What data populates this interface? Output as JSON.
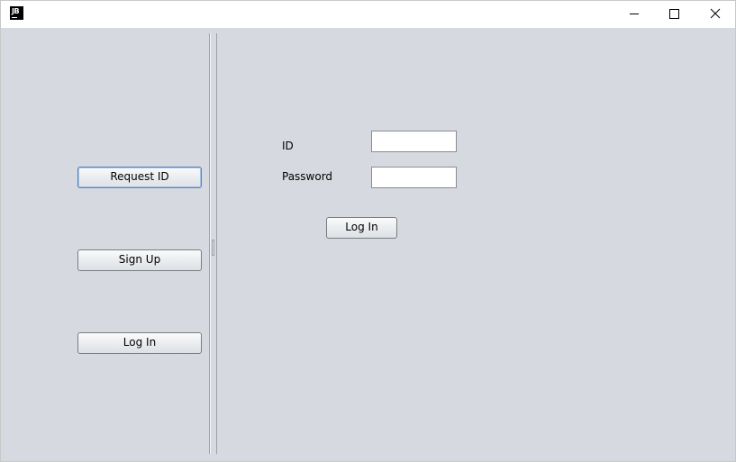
{
  "window": {
    "icon_text": "JB",
    "controls": {
      "minimize_icon": "minimize-icon",
      "maximize_icon": "maximize-icon",
      "close_icon": "close-icon"
    }
  },
  "left_panel": {
    "request_id_label": "Request ID",
    "sign_up_label": "Sign Up",
    "log_in_label": "Log In"
  },
  "login_form": {
    "id_label": "ID",
    "id_value": "",
    "password_label": "Password",
    "password_value": "",
    "submit_label": "Log In"
  },
  "colors": {
    "background": "#d6d9df",
    "titlebar": "#ffffff"
  }
}
